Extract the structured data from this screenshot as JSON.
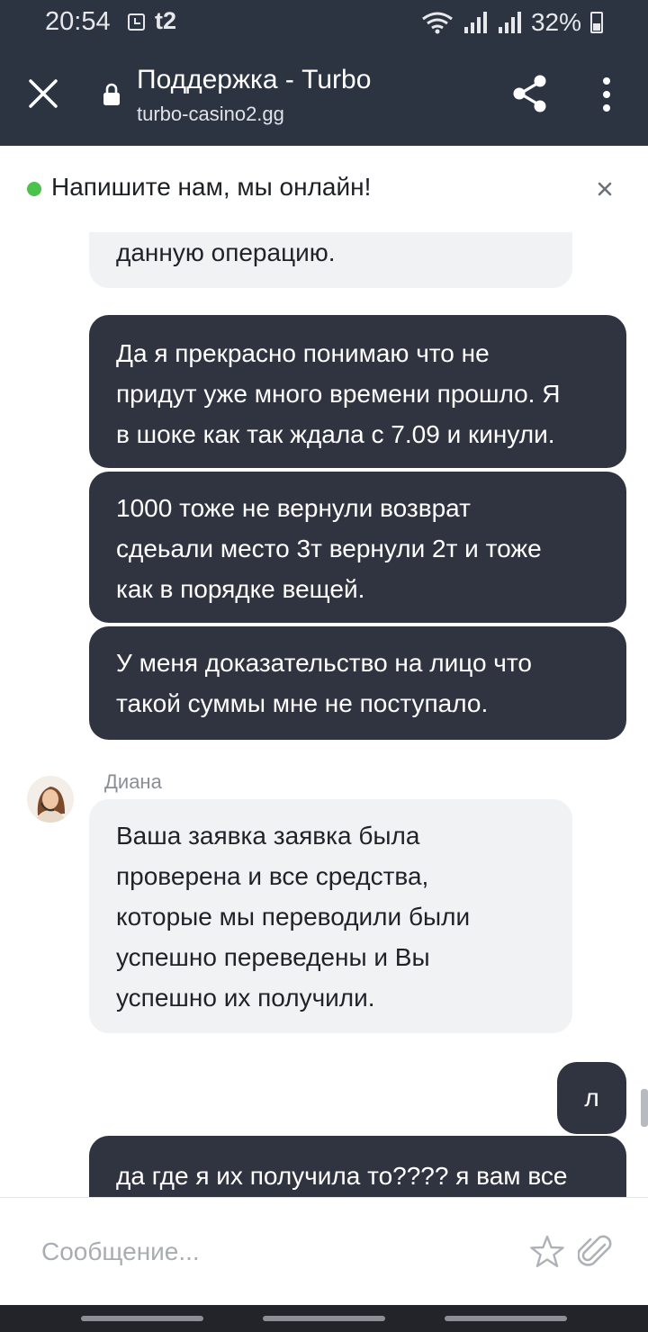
{
  "status_bar": {
    "time": "20:54",
    "carrier": "t2",
    "battery": "32%"
  },
  "browser": {
    "title": "Поддержка - Turbo",
    "url": "turbo-casino2.gg"
  },
  "banner": {
    "text": "Напишите нам, мы онлайн!"
  },
  "messages": [
    {
      "side": "in",
      "lines": [
        "данную операцию."
      ]
    },
    {
      "side": "out",
      "lines": [
        "Да я прекрасно понимаю что не",
        "придут уже много времени прошло. Я",
        "в шоке как так ждала с 7.09 и кинули."
      ]
    },
    {
      "side": "out",
      "lines": [
        "1000 тоже не вернули возврат",
        "сдеьали место 3т вернули 2т и тоже",
        "как в порядке вещей."
      ]
    },
    {
      "side": "out",
      "lines": [
        "У меня доказательство на лицо что",
        "такой суммы мне не поступало."
      ]
    },
    {
      "side": "in",
      "lines": [
        "Ваша заявка заявка была",
        "проверена и все средства,",
        "которые мы переводили были",
        "успешно переведены и Вы",
        "успешно их получили."
      ]
    },
    {
      "side": "out",
      "lines": [
        "л"
      ]
    },
    {
      "side": "out",
      "lines": [
        "да где я их получила то???? я вам все"
      ]
    }
  ],
  "agent": {
    "name": "Диана"
  },
  "composer": {
    "placeholder": "Сообщение..."
  },
  "colors": {
    "header_bg": "#2c3441",
    "outgoing_bubble": "#2f3440",
    "incoming_bubble": "#f1f2f4",
    "online": "#4cc24c"
  },
  "icons": [
    "close-icon",
    "lock-icon",
    "share-icon",
    "more-vert-icon",
    "close-icon",
    "star-icon",
    "paperclip-icon"
  ]
}
